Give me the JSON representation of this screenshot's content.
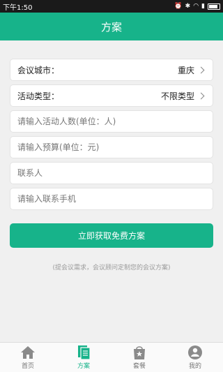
{
  "status_bar": {
    "time": "下午1:50",
    "icons": [
      "alarm-icon",
      "bluetooth-icon",
      "wifi-icon",
      "signal-icon",
      "battery-icon"
    ]
  },
  "header": {
    "title": "方案"
  },
  "form": {
    "city": {
      "label": "会议城市：",
      "value": "重庆"
    },
    "activity_type": {
      "label": "活动类型：",
      "value": "不限类型"
    },
    "attendees": {
      "placeholder": "请输入活动人数(单位：人)",
      "value": ""
    },
    "budget": {
      "placeholder": "请输入预算(单位：元)",
      "value": ""
    },
    "contact": {
      "placeholder": "联系人",
      "value": ""
    },
    "phone": {
      "placeholder": "请输入联系手机",
      "value": ""
    }
  },
  "submit_label": "立即获取免费方案",
  "hint": "(提会议需求，会议顾问定制您的会议方案)",
  "tabs": [
    {
      "label": "首页",
      "icon": "home-icon",
      "active": false
    },
    {
      "label": "方案",
      "icon": "document-icon",
      "active": true
    },
    {
      "label": "套餐",
      "icon": "package-icon",
      "active": false
    },
    {
      "label": "我的",
      "icon": "profile-icon",
      "active": false
    }
  ],
  "colors": {
    "accent": "#17b38a",
    "status_bar": "#1a1a1a",
    "background": "#f0f0f0"
  }
}
